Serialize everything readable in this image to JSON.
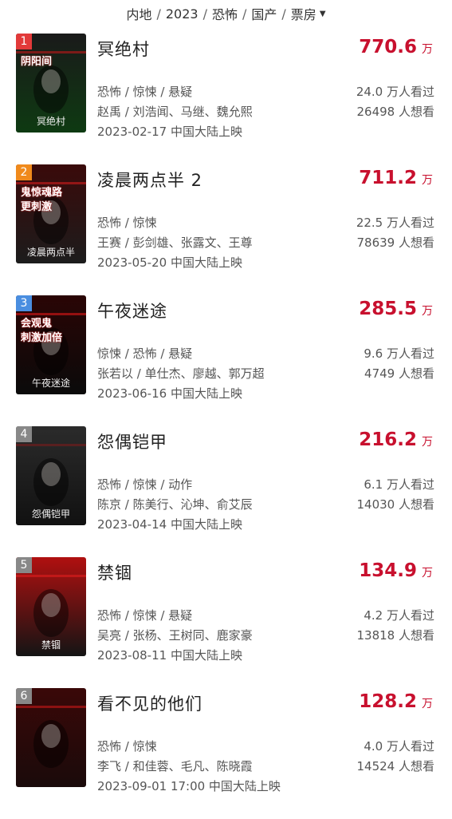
{
  "filters": {
    "region": "内地",
    "year": "2023",
    "genre": "恐怖",
    "origin": "国产",
    "sort": "票房"
  },
  "movies": [
    {
      "rank": "1",
      "title": "冥绝村",
      "box_value": "770.6",
      "box_unit": "万",
      "genres": "恐怖 / 惊悚 / 悬疑",
      "cast": "赵禹 / 刘浩闻、马继、魏允熙",
      "release": "2023-02-17 中国大陆上映",
      "watched": "24.0 万人看过",
      "wanted": "26498 人想看",
      "rank_color": "#e23a3a",
      "poster": {
        "bg_top": "#1a1a1a",
        "bg_bottom": "#0e3a12",
        "accent": "#c01818",
        "text_top": "阴阳间",
        "text_mid": "",
        "text_bottom": "冥绝村"
      }
    },
    {
      "rank": "2",
      "title": "凌晨两点半 2",
      "box_value": "711.2",
      "box_unit": "万",
      "genres": "恐怖 / 惊悚",
      "cast": "王赛 / 彭剑雄、张露文、王尊",
      "release": "2023-05-20 中国大陆上映",
      "watched": "22.5 万人看过",
      "wanted": "78639 人想看",
      "rank_color": "#f08a1c",
      "poster": {
        "bg_top": "#3a0a0a",
        "bg_bottom": "#1c1c1c",
        "accent": "#d21c1c",
        "text_top": "鬼惊魂路",
        "text_mid": "更刺激",
        "text_bottom": "凌晨两点半"
      }
    },
    {
      "rank": "3",
      "title": "午夜迷途",
      "box_value": "285.5",
      "box_unit": "万",
      "genres": "惊悚 / 恐怖 / 悬疑",
      "cast": "张若以 / 单仕杰、廖越、郭万超",
      "release": "2023-06-16 中国大陆上映",
      "watched": "9.6 万人看过",
      "wanted": "4749 人想看",
      "rank_color": "#4a8ee0",
      "poster": {
        "bg_top": "#2a0505",
        "bg_bottom": "#0a0a0a",
        "accent": "#e01818",
        "text_top": "会观鬼",
        "text_mid": "刺激加倍",
        "text_bottom": "午夜迷途"
      }
    },
    {
      "rank": "4",
      "title": "怨偶铠甲",
      "box_value": "216.2",
      "box_unit": "万",
      "genres": "恐怖 / 惊悚 / 动作",
      "cast": "陈京 / 陈美行、沁坤、俞艾辰",
      "release": "2023-04-14 中国大陆上映",
      "watched": "6.1 万人看过",
      "wanted": "14030 人想看",
      "rank_color": "#888888",
      "poster": {
        "bg_top": "#2b2b2b",
        "bg_bottom": "#111111",
        "accent": "#7a1a1a",
        "text_top": "",
        "text_mid": "",
        "text_bottom": "怨偶铠甲"
      }
    },
    {
      "rank": "5",
      "title": "禁锢",
      "box_value": "134.9",
      "box_unit": "万",
      "genres": "恐怖 / 惊悚 / 悬疑",
      "cast": "吴亮 / 张杨、王树同、鹿家豪",
      "release": "2023-08-11 中国大陆上映",
      "watched": "4.2 万人看过",
      "wanted": "13818 人想看",
      "rank_color": "#888888",
      "poster": {
        "bg_top": "#b01010",
        "bg_bottom": "#141414",
        "accent": "#e02020",
        "text_top": "",
        "text_mid": "",
        "text_bottom": "禁锢"
      }
    },
    {
      "rank": "6",
      "title": "看不见的他们",
      "box_value": "128.2",
      "box_unit": "万",
      "genres": "恐怖 / 惊悚",
      "cast": "李飞 / 和佳蓉、毛凡、陈晓霞",
      "release": "2023-09-01 17:00 中国大陆上映",
      "watched": "4.0 万人看过",
      "wanted": "14524 人想看",
      "rank_color": "#888888",
      "poster": {
        "bg_top": "#3a0808",
        "bg_bottom": "#1a0a0a",
        "accent": "#c81818",
        "text_top": "",
        "text_mid": "",
        "text_bottom": ""
      }
    }
  ]
}
